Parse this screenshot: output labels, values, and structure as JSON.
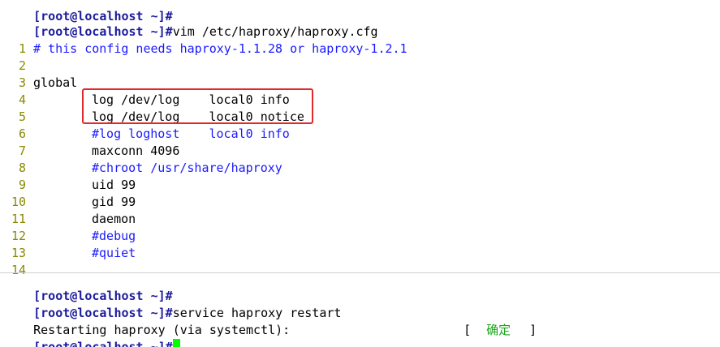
{
  "top": {
    "clipped_prompt": "[root@localhost ~]#",
    "command": {
      "prompt": "[root@localhost ~]#",
      "text": "vim /etc/haproxy/haproxy.cfg"
    },
    "lines": [
      {
        "n": "1",
        "text": "# this config needs haproxy-1.1.28 or haproxy-1.2.1",
        "kind": "comment",
        "indent": 0
      },
      {
        "n": "2",
        "text": "",
        "kind": "code",
        "indent": 0
      },
      {
        "n": "3",
        "text": "global",
        "kind": "code",
        "indent": 0
      },
      {
        "n": "4",
        "text": "log /dev/log    local0 info",
        "kind": "code",
        "indent": 1
      },
      {
        "n": "5",
        "text": "log /dev/log    local0 notice",
        "kind": "code",
        "indent": 1
      },
      {
        "n": "6",
        "text": "#log loghost    local0 info",
        "kind": "comment",
        "indent": 1
      },
      {
        "n": "7",
        "text": "maxconn 4096",
        "kind": "code",
        "indent": 1
      },
      {
        "n": "8",
        "text": "#chroot /usr/share/haproxy",
        "kind": "comment",
        "indent": 1
      },
      {
        "n": "9",
        "text": "uid 99",
        "kind": "code",
        "indent": 1
      },
      {
        "n": "10",
        "text": "gid 99",
        "kind": "code",
        "indent": 1
      },
      {
        "n": "11",
        "text": "daemon",
        "kind": "code",
        "indent": 1
      },
      {
        "n": "12",
        "text": "#debug",
        "kind": "comment",
        "indent": 1
      },
      {
        "n": "13",
        "text": "#quiet",
        "kind": "comment",
        "indent": 1
      },
      {
        "n": "14",
        "text": "",
        "kind": "code",
        "indent": 0
      }
    ]
  },
  "bottom": {
    "line1_prompt": "[root@localhost ~]#",
    "line2": {
      "prompt": "[root@localhost ~]#",
      "text": "service haproxy restart"
    },
    "line3": {
      "text": "Restarting haproxy (via systemctl):",
      "bracket_open": "[",
      "status": "确定",
      "bracket_close": "]"
    },
    "line4_prompt": "[root@localhost ~]#"
  },
  "colors": {
    "prompt": "#1c1c9c",
    "comment": "#1a1aff",
    "line_number": "#8a8a00",
    "ok_status": "#19a519",
    "cursor": "#00ff00",
    "highlight": "#e02a2a"
  }
}
